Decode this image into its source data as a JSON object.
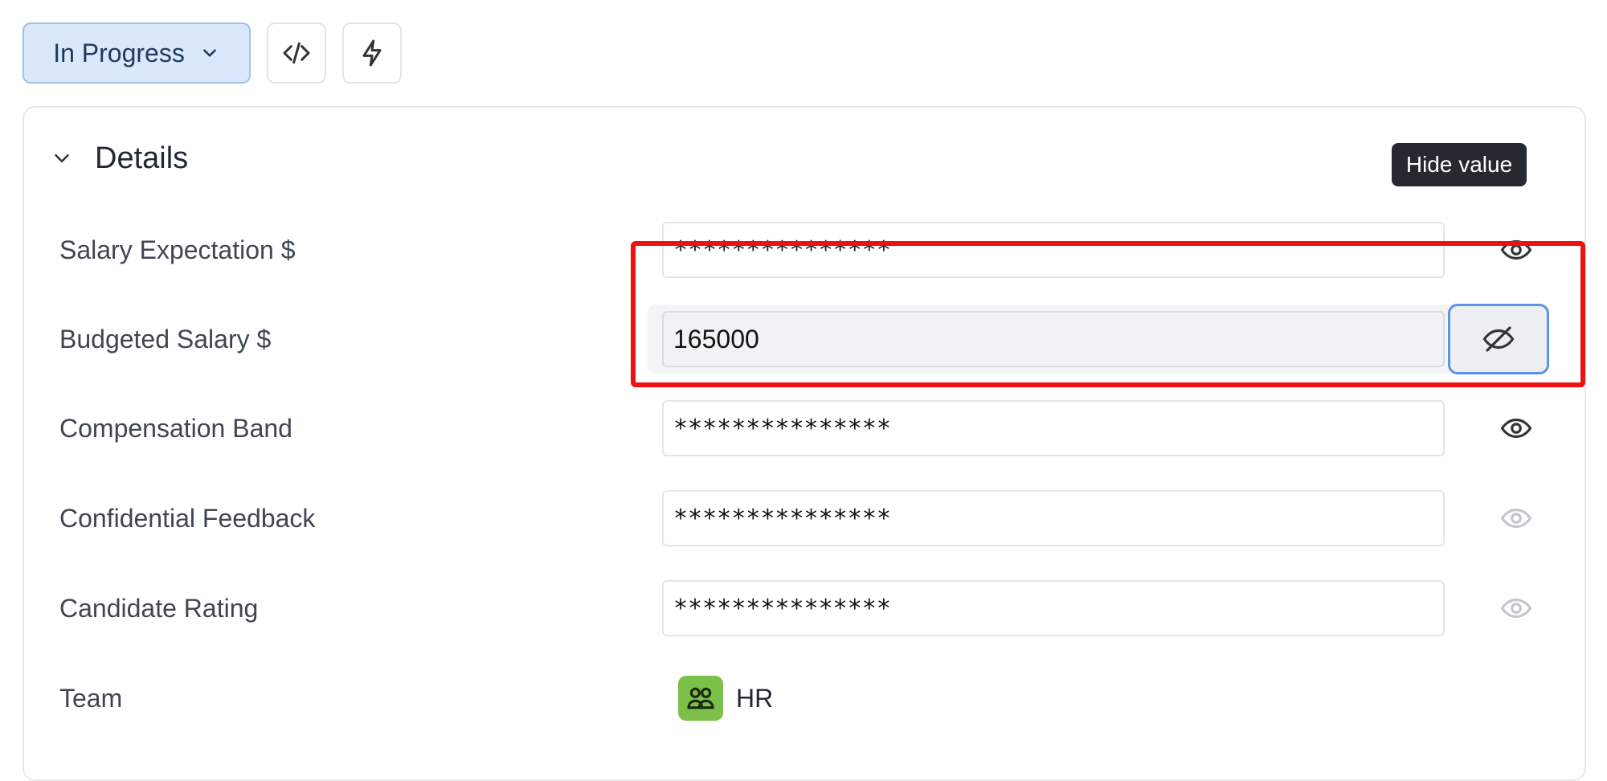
{
  "toolbar": {
    "status_label": "In Progress",
    "status_icon": "chevron-down-icon",
    "code_icon": "code-icon",
    "action_icon": "lightning-icon"
  },
  "section": {
    "title": "Details",
    "toggle_icon": "chevron-down-icon"
  },
  "fields": [
    {
      "label": "Salary Expectation $",
      "value": "***************",
      "visibility_icon": "eye-icon"
    },
    {
      "label": "Budgeted Salary $",
      "value": "165000",
      "visibility_icon": "eye-off-icon"
    },
    {
      "label": "Compensation Band",
      "value": "***************",
      "visibility_icon": "eye-icon"
    },
    {
      "label": "Confidential Feedback",
      "value": "***************",
      "visibility_icon": "eye-icon"
    },
    {
      "label": "Candidate Rating",
      "value": "***************",
      "visibility_icon": "eye-icon"
    }
  ],
  "team": {
    "label": "Team",
    "value": "HR",
    "icon": "team-icon",
    "icon_color": "#7cc04a"
  },
  "tooltip": {
    "text": "Hide value"
  },
  "colors": {
    "status_bg": "#dbe8fb",
    "focus_ring": "#5b93e6",
    "highlight": "#ee1111",
    "tooltip_bg": "#262a30"
  }
}
